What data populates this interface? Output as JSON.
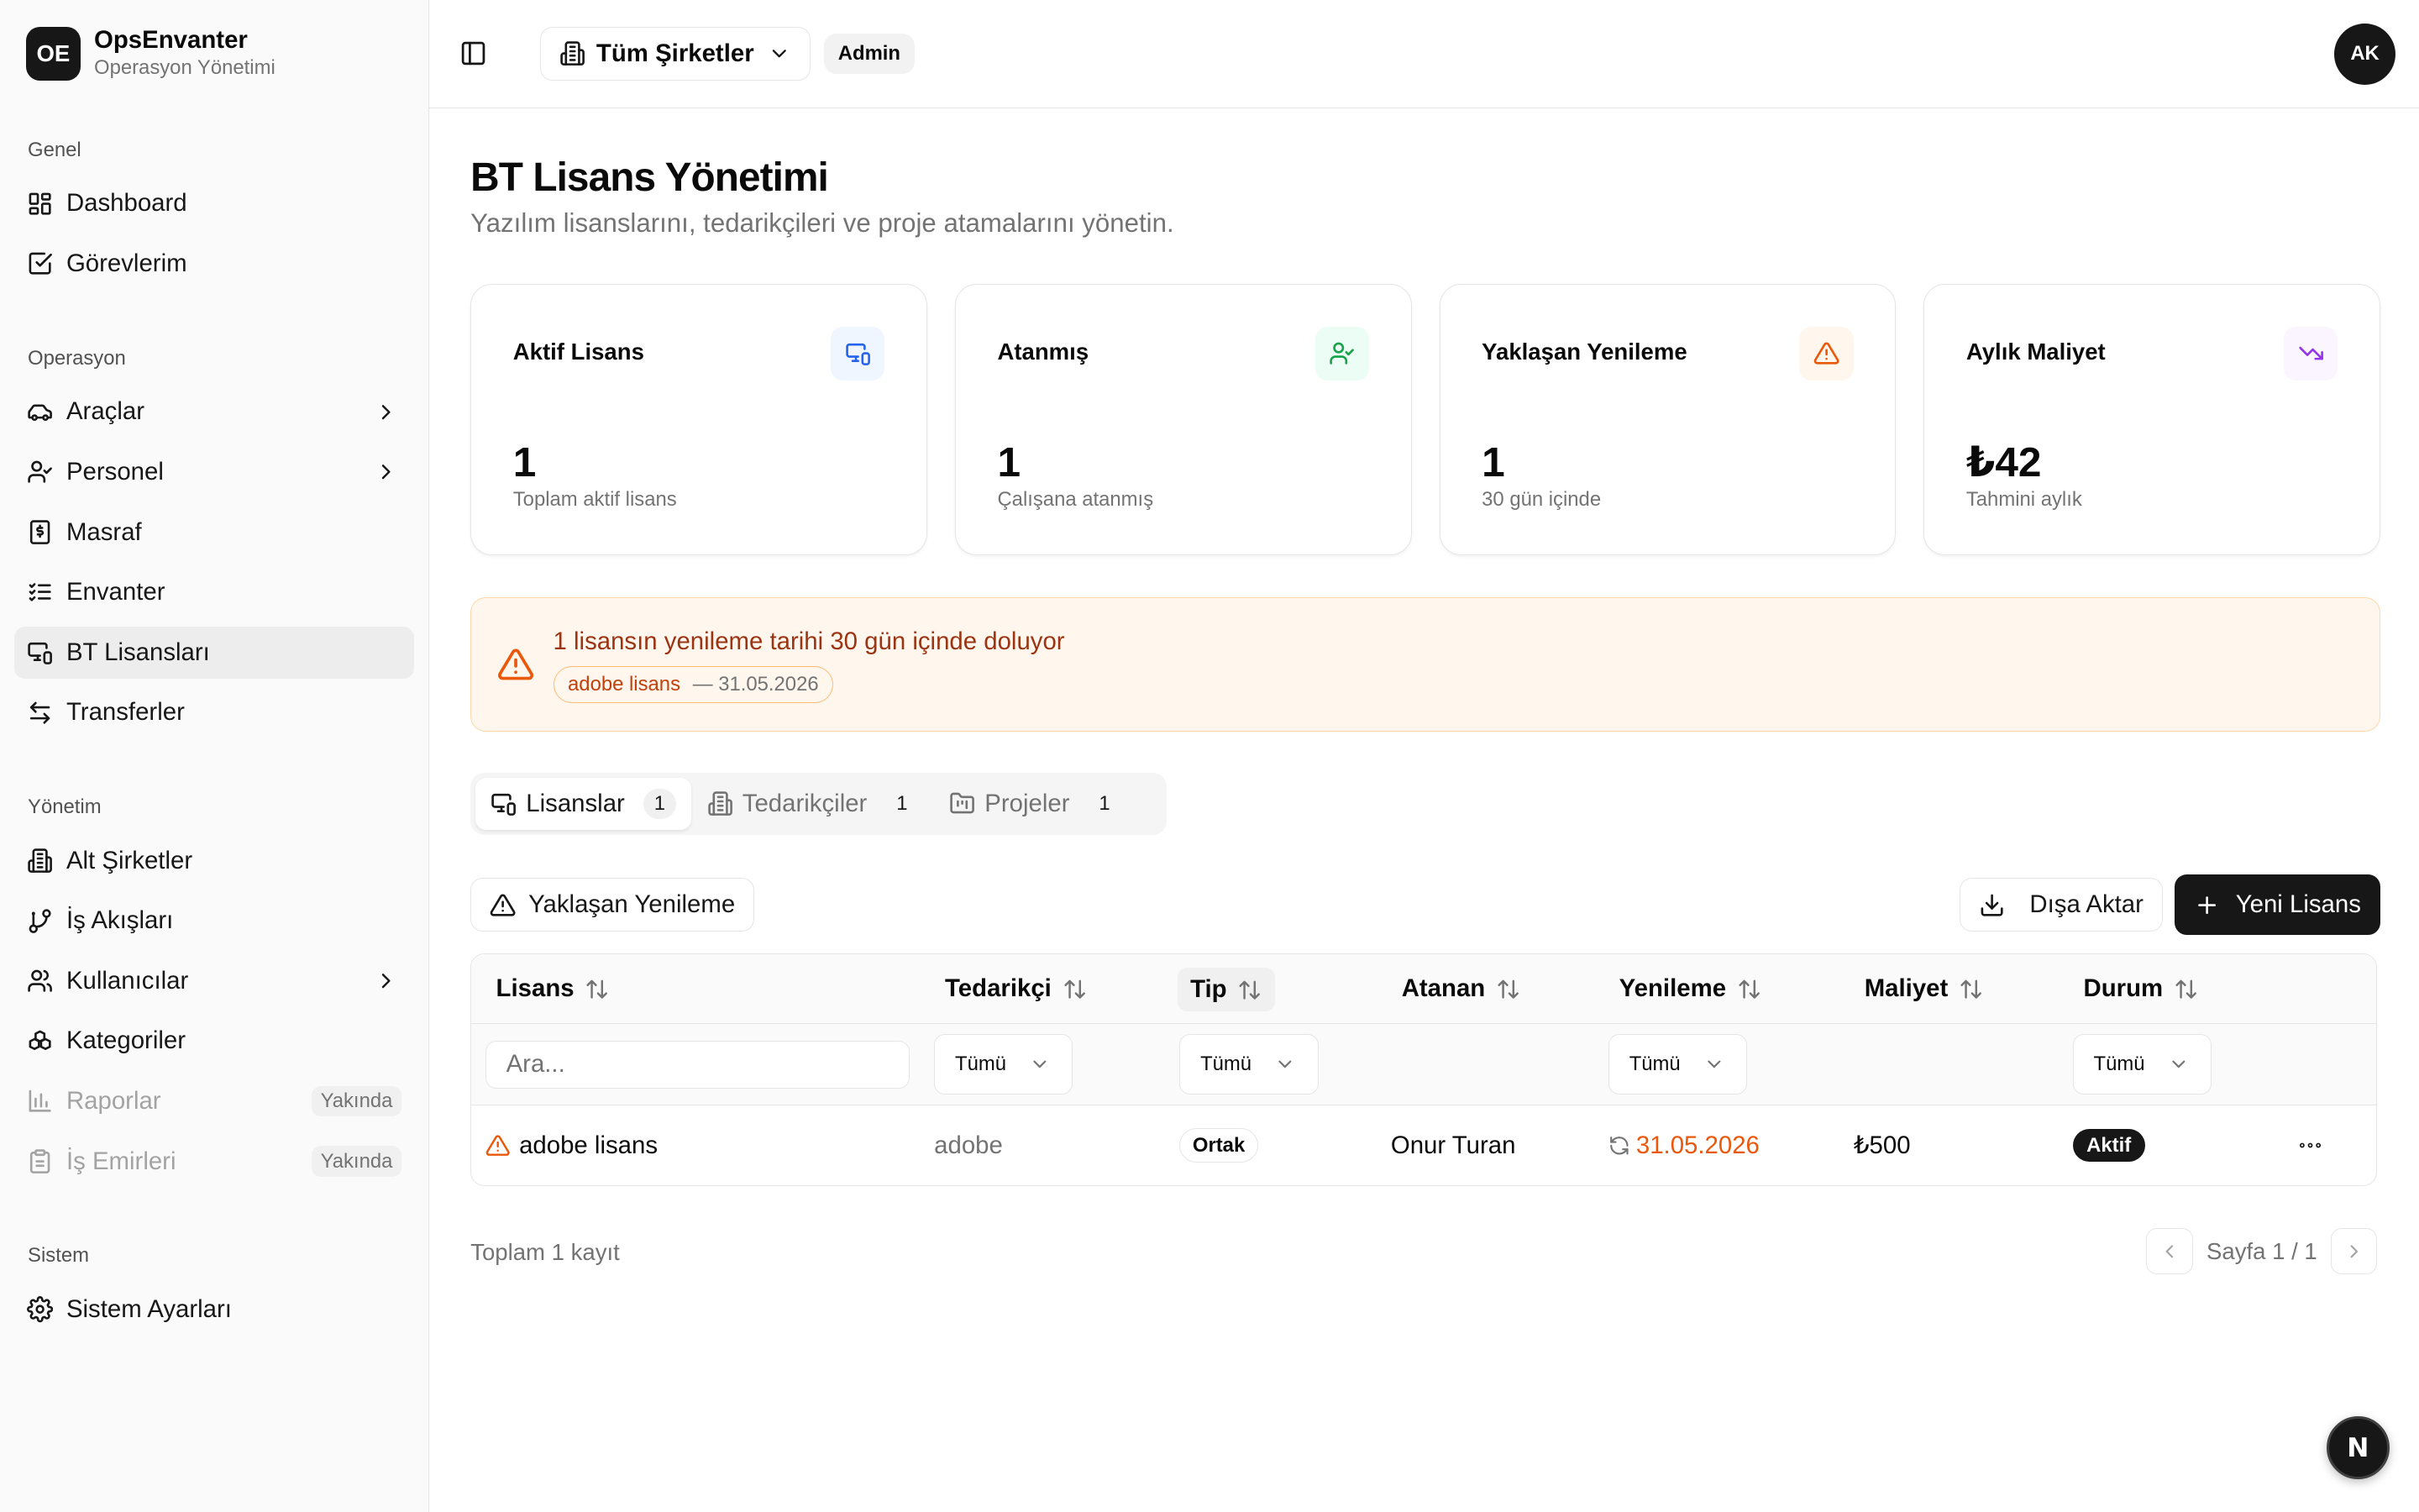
{
  "brand": {
    "logo": "OE",
    "name": "OpsEnvanter",
    "subtitle": "Operasyon Yönetimi"
  },
  "sidebar": {
    "groups": [
      {
        "label": "Genel",
        "items": [
          {
            "label": "Dashboard",
            "icon": "dashboard-icon"
          },
          {
            "label": "Görevlerim",
            "icon": "checkbox-icon"
          }
        ]
      },
      {
        "label": "Operasyon",
        "items": [
          {
            "label": "Araçlar",
            "icon": "car-icon",
            "chevron": true
          },
          {
            "label": "Personel",
            "icon": "user-check-icon",
            "chevron": true
          },
          {
            "label": "Masraf",
            "icon": "receipt-icon"
          },
          {
            "label": "Envanter",
            "icon": "list-check-icon"
          },
          {
            "label": "BT Lisansları",
            "icon": "monitor-smartphone-icon",
            "active": true
          },
          {
            "label": "Transferler",
            "icon": "arrows-icon"
          }
        ]
      },
      {
        "label": "Yönetim",
        "items": [
          {
            "label": "Alt Şirketler",
            "icon": "building-icon"
          },
          {
            "label": "İş Akışları",
            "icon": "git-branch-icon"
          },
          {
            "label": "Kullanıcılar",
            "icon": "users-icon",
            "chevron": true
          },
          {
            "label": "Kategoriler",
            "icon": "boxes-icon"
          },
          {
            "label": "Raporlar",
            "icon": "chart-icon",
            "badge": "Yakında",
            "disabled": true
          },
          {
            "label": "İş Emirleri",
            "icon": "clipboard-icon",
            "badge": "Yakında",
            "disabled": true
          }
        ]
      },
      {
        "label": "Sistem",
        "items": [
          {
            "label": "Sistem Ayarları",
            "icon": "gear-icon"
          }
        ]
      }
    ]
  },
  "topbar": {
    "company": "Tüm Şirketler",
    "role": "Admin",
    "avatar": "AK"
  },
  "page": {
    "title": "BT Lisans Yönetimi",
    "subtitle": "Yazılım lisanslarını, tedarikçileri ve proje atamalarını yönetin."
  },
  "stats": [
    {
      "title": "Aktif Lisans",
      "value": "1",
      "desc": "Toplam aktif lisans",
      "icon": "monitor-smartphone-icon",
      "bg": "#eff6ff",
      "color": "#2563eb"
    },
    {
      "title": "Atanmış",
      "value": "1",
      "desc": "Çalışana atanmış",
      "icon": "user-check-icon",
      "bg": "#ecfdf5",
      "color": "#16a34a"
    },
    {
      "title": "Yaklaşan Yenileme",
      "value": "1",
      "desc": "30 gün içinde",
      "icon": "alert-triangle-icon",
      "bg": "#fff7ed",
      "color": "#ea580c"
    },
    {
      "title": "Aylık Maliyet",
      "value": "₺42",
      "desc": "Tahmini aylık",
      "icon": "trending-down-icon",
      "bg": "#faf5ff",
      "color": "#9333ea"
    }
  ],
  "alert": {
    "title": "1 lisansın yenileme tarihi 30 gün içinde doluyor",
    "chip_name": "adobe lisans",
    "chip_date": "— 31.05.2026"
  },
  "tabs": [
    {
      "label": "Lisanslar",
      "count": "1",
      "icon": "monitor-smartphone-icon",
      "active": true
    },
    {
      "label": "Tedarikçiler",
      "count": "1",
      "icon": "building-icon"
    },
    {
      "label": "Projeler",
      "count": "1",
      "icon": "folder-icon"
    }
  ],
  "toolbar": {
    "renewal_filter": "Yaklaşan Yenileme",
    "export": "Dışa Aktar",
    "new": "Yeni Lisans"
  },
  "table": {
    "columns": [
      "Lisans",
      "Tedarikçi",
      "Tip",
      "Atanan",
      "Yenileme",
      "Maliyet",
      "Durum"
    ],
    "search_placeholder": "Ara...",
    "filter_all": "Tümü",
    "rows": [
      {
        "license": "adobe lisans",
        "vendor": "adobe",
        "type": "Ortak",
        "assignee": "Onur Turan",
        "renewal": "31.05.2026",
        "cost": "₺500",
        "status": "Aktif"
      }
    ]
  },
  "footer": {
    "total": "Toplam 1 kayıt",
    "page": "Sayfa 1 / 1"
  },
  "fab": {
    "label": "N"
  }
}
